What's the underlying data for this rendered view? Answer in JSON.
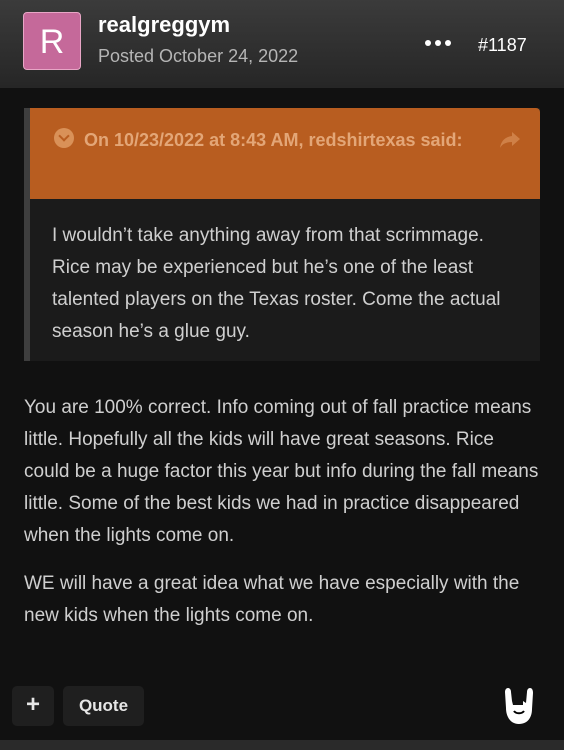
{
  "post": {
    "avatar_letter": "R",
    "username": "realgreggym",
    "posted": "Posted October 24, 2022",
    "post_number": "#1187"
  },
  "quote": {
    "citation": "On 10/23/2022 at 8:43 AM, redshirtexas said:",
    "text": "I wouldn’t take anything away from that scrimmage. Rice may be experienced but he’s one of the least talented players on the Texas roster. Come the actual season he’s a glue guy."
  },
  "body": {
    "paragraphs": [
      "You are 100% correct. Info coming out of fall practice means little. Hopefully all the kids will have great seasons. Rice could be a huge factor this year but info during the fall means little. Some of the best kids we had in practice disappeared when the lights come on.",
      "WE will have a great idea what we have especially with the new kids when the lights come on."
    ]
  },
  "actions": {
    "add_label": "+",
    "quote_label": "Quote"
  },
  "icons": [
    "more-icon",
    "chevron-down-icon",
    "share-icon",
    "horns-reaction-icon"
  ],
  "colors": {
    "avatar": "#c5699a",
    "quote_header": "#b85d20",
    "quote_citation": "#e3a677"
  }
}
